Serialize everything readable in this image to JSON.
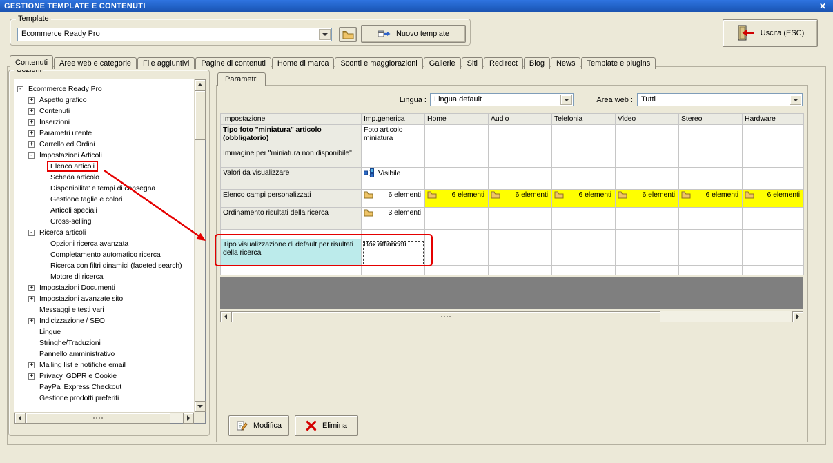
{
  "window": {
    "title": "GESTIONE TEMPLATE E CONTENUTI",
    "close_glyph": "✕"
  },
  "toolbar": {
    "group_label": "Template",
    "template_value": "Ecommerce Ready Pro",
    "new_template_label": "Nuovo template",
    "exit_label": "Uscita (ESC)"
  },
  "active_tab": "Contenuti",
  "tabs": [
    "Contenuti",
    "Aree web e categorie",
    "File aggiuntivi",
    "Pagine di contenuti",
    "Home di marca",
    "Sconti e maggiorazioni",
    "Gallerie",
    "Siti",
    "Redirect",
    "Blog",
    "News",
    "Template e plugins"
  ],
  "sections": {
    "group_label": "Sezioni",
    "tree": [
      {
        "label": "Ecommerce Ready Pro",
        "level": 0,
        "toggle": "-"
      },
      {
        "label": "Aspetto grafico",
        "level": 1,
        "toggle": "+"
      },
      {
        "label": "Contenuti",
        "level": 1,
        "toggle": "+"
      },
      {
        "label": "Inserzioni",
        "level": 1,
        "toggle": "+"
      },
      {
        "label": "Parametri utente",
        "level": 1,
        "toggle": "+"
      },
      {
        "label": "Carrello ed Ordini",
        "level": 1,
        "toggle": "+"
      },
      {
        "label": "Impostazioni Articoli",
        "level": 1,
        "toggle": "-"
      },
      {
        "label": "Elenco articoli",
        "level": 2,
        "toggle": "",
        "highlight": true
      },
      {
        "label": "Scheda articolo",
        "level": 2,
        "toggle": ""
      },
      {
        "label": "Disponibilita' e tempi di consegna",
        "level": 2,
        "toggle": ""
      },
      {
        "label": "Gestione taglie e colori",
        "level": 2,
        "toggle": ""
      },
      {
        "label": "Articoli speciali",
        "level": 2,
        "toggle": ""
      },
      {
        "label": "Cross-selling",
        "level": 2,
        "toggle": ""
      },
      {
        "label": "Ricerca articoli",
        "level": 1,
        "toggle": "-"
      },
      {
        "label": "Opzioni ricerca avanzata",
        "level": 2,
        "toggle": ""
      },
      {
        "label": "Completamento automatico ricerca",
        "level": 2,
        "toggle": ""
      },
      {
        "label": "Ricerca con filtri dinamici (faceted search)",
        "level": 2,
        "toggle": ""
      },
      {
        "label": "Motore di ricerca",
        "level": 2,
        "toggle": ""
      },
      {
        "label": "Impostazioni Documenti",
        "level": 1,
        "toggle": "+"
      },
      {
        "label": "Impostazioni avanzate sito",
        "level": 1,
        "toggle": "+"
      },
      {
        "label": "Messaggi e testi vari",
        "level": 1,
        "toggle": ""
      },
      {
        "label": "Indicizzazione / SEO",
        "level": 1,
        "toggle": "+"
      },
      {
        "label": "Lingue",
        "level": 1,
        "toggle": ""
      },
      {
        "label": "Stringhe/Traduzioni",
        "level": 1,
        "toggle": ""
      },
      {
        "label": "Pannello amministrativo",
        "level": 1,
        "toggle": ""
      },
      {
        "label": "Mailing list e notifiche email",
        "level": 1,
        "toggle": "+"
      },
      {
        "label": "Privacy, GDPR e Cookie",
        "level": 1,
        "toggle": "+"
      },
      {
        "label": "PayPal Express Checkout",
        "level": 1,
        "toggle": ""
      },
      {
        "label": "Gestione prodotti preferiti",
        "level": 1,
        "toggle": ""
      }
    ]
  },
  "parameters": {
    "tab_label": "Parametri",
    "language_label": "Lingua :",
    "language_value": "Lingua default",
    "area_label": "Area web :",
    "area_value": "Tutti",
    "table": {
      "columns": [
        "Impostazione",
        "Imp.generica",
        "Home",
        "Audio",
        "Telefonia",
        "Video",
        "Stereo",
        "Hardware"
      ],
      "rows": [
        {
          "name": "Tipo foto \"miniatura\" articolo (obbligatorio)",
          "bold": true,
          "generic": "Foto articolo miniatura"
        },
        {
          "name": "Immagine per \"miniatura non disponibile\"",
          "generic": ""
        },
        {
          "name": "Valori da visualizzare",
          "generic": "Visibile",
          "icon": "sitemap-icon"
        },
        {
          "name": "Elenco campi personalizzati",
          "generic": "6 elementi",
          "icon": "folder-icon",
          "value_align": "right",
          "sites": [
            "6 elementi",
            "6 elementi",
            "6 elementi",
            "6 elementi",
            "6 elementi",
            "6 elementi"
          ],
          "sites_icon": "folder-icon",
          "sites_bg": "#FFFF00"
        },
        {
          "name": "Ordinamento risultati della ricerca",
          "generic": "3 elementi",
          "icon": "folder-icon",
          "value_align": "right"
        },
        {
          "name": "Tipo visualizzazione di default per risultati della ricerca",
          "generic": "Box affiancati",
          "name_bg": "#BCEBEB",
          "editing": true
        }
      ]
    },
    "modify_label": "Modifica",
    "delete_label": "Elimina"
  },
  "colors": {
    "highlight_yellow": "#FFFF00",
    "highlight_cyan": "#BCEBEB",
    "annotation_red": "#E50000"
  }
}
